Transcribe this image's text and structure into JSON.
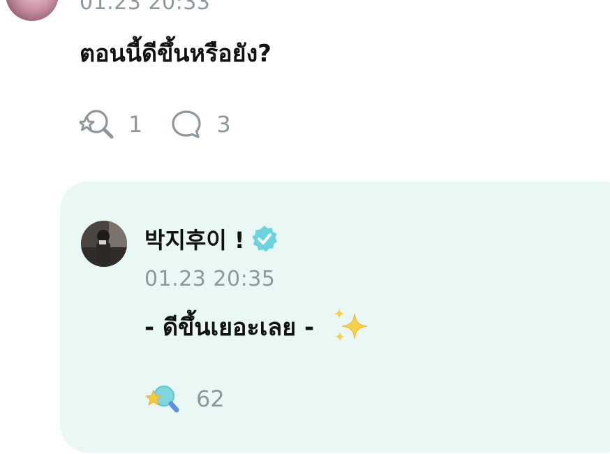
{
  "comment": {
    "timestamp": "01.23 20:33",
    "text": "ตอนนี้ดีขึ้นหรือยัง?",
    "like_count": "1",
    "reply_count": "3",
    "like_icon": "star-magnifier-outline-icon",
    "reply_icon": "speech-bubble-icon"
  },
  "reply": {
    "author": "박지후이 !",
    "verified_icon": "verified-badge-icon",
    "timestamp": "01.23 20:35",
    "text": "- ดีขึ้นเยอะเลย -",
    "emoji": "sparkles-icon",
    "like_count": "62",
    "like_icon": "star-magnifier-filled-icon"
  },
  "colors": {
    "card_background": "#e9f8f5",
    "muted_text": "#8e969c",
    "verified": "#6cd3dd",
    "sparkle": "#f5c842",
    "primary_text": "#111111"
  }
}
